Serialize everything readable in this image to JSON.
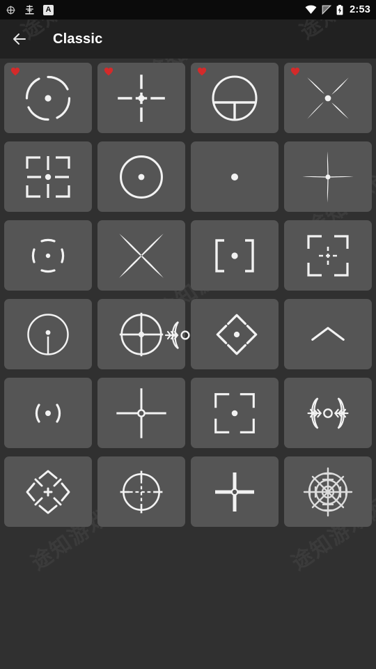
{
  "app": {
    "background_color": "#303030",
    "tile_color": "#555555",
    "stroke_color": "#ffffff",
    "accent_color": "#d32f2f"
  },
  "statusbar": {
    "background_color": "#0b0b0b",
    "time": "2:53",
    "left_icons": [
      {
        "name": "crosshair-app-icon",
        "glyph": "target"
      },
      {
        "name": "game-overlay-icon",
        "glyph": "chinese-char"
      },
      {
        "name": "translate-badge-icon",
        "label": "A"
      }
    ],
    "right_icons": [
      {
        "name": "wifi-icon"
      },
      {
        "name": "signal-icon"
      },
      {
        "name": "battery-charging-icon"
      }
    ]
  },
  "toolbar": {
    "background_color": "#212121",
    "back_label": "Back",
    "title": "Classic"
  },
  "watermark": {
    "text": "途知游戏网"
  },
  "grid": {
    "columns": 4,
    "rows": 6,
    "tiles": [
      {
        "id": 1,
        "name": "crosshair-dashed-ring-dot",
        "favorite": true
      },
      {
        "id": 2,
        "name": "crosshair-gapped-plus-dot",
        "favorite": true
      },
      {
        "id": 3,
        "name": "crosshair-circle-t-reticle",
        "favorite": true
      },
      {
        "id": 4,
        "name": "crosshair-tapered-x-dot",
        "favorite": true
      },
      {
        "id": 5,
        "name": "crosshair-corner-brackets-dot",
        "favorite": false
      },
      {
        "id": 6,
        "name": "crosshair-circle-dot",
        "favorite": false
      },
      {
        "id": 7,
        "name": "crosshair-single-dot",
        "favorite": false
      },
      {
        "id": 8,
        "name": "crosshair-thin-tapered-plus",
        "favorite": false
      },
      {
        "id": 9,
        "name": "crosshair-arcs-parens-dot",
        "favorite": false
      },
      {
        "id": 10,
        "name": "crosshair-thin-x",
        "favorite": false
      },
      {
        "id": 11,
        "name": "crosshair-brackets-dot",
        "favorite": false
      },
      {
        "id": 12,
        "name": "crosshair-frame-corners-plus",
        "favorite": false
      },
      {
        "id": 13,
        "name": "crosshair-circle-dot-stem",
        "favorite": false
      },
      {
        "id": 14,
        "name": "crosshair-scope-circle-cross",
        "favorite": false
      },
      {
        "id": 15,
        "name": "crosshair-diamond-chevrons-dot",
        "favorite": false
      },
      {
        "id": 16,
        "name": "crosshair-chevron-up",
        "favorite": false
      },
      {
        "id": 17,
        "name": "crosshair-parens-dot",
        "favorite": false
      },
      {
        "id": 18,
        "name": "crosshair-plus-small-circle",
        "favorite": false
      },
      {
        "id": 19,
        "name": "crosshair-camera-frame-dot",
        "favorite": false
      },
      {
        "id": 20,
        "name": "crosshair-feather-wings-circle",
        "favorite": false
      },
      {
        "id": 21,
        "name": "crosshair-petal-frame-plus",
        "favorite": false
      },
      {
        "id": 22,
        "name": "crosshair-scope-dotted-cross",
        "favorite": false
      },
      {
        "id": 23,
        "name": "crosshair-thick-plus-circle",
        "favorite": false
      },
      {
        "id": 24,
        "name": "crosshair-radar-reticle",
        "favorite": false
      }
    ]
  }
}
